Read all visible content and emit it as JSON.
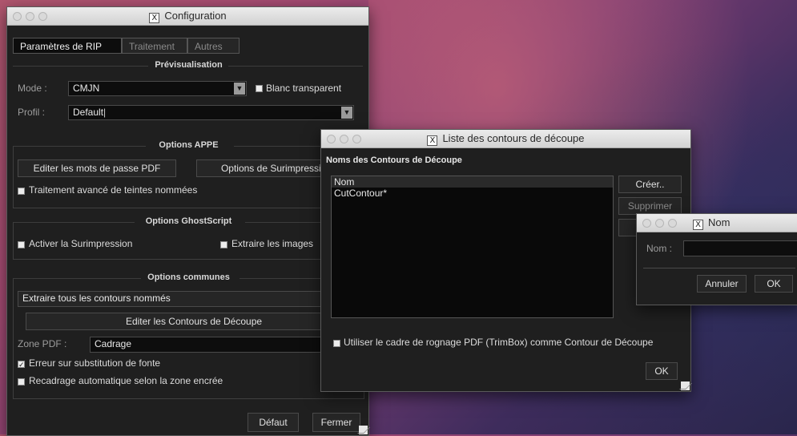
{
  "config": {
    "title": "Configuration",
    "tabs": [
      "Paramètres de RIP",
      "Traitement",
      "Autres"
    ],
    "preview": {
      "title": "Prévisualisation",
      "mode_label": "Mode",
      "mode_value": "CMJN",
      "white_label": "Blanc transparent",
      "profile_label": "Profil",
      "profile_value": "Default"
    },
    "appe": {
      "title": "Options APPE",
      "btn_passwords": "Editer les mots de passe PDF",
      "btn_overprint": "Options de Surimpression",
      "advanced_label": "Traitement avancé de teintes nommées"
    },
    "ghost": {
      "title": "Options GhostScript",
      "overprint_label": "Activer la Surimpression",
      "extract_label": "Extraire les images"
    },
    "common": {
      "title": "Options communes",
      "extract_value": "Extraire tous les contours nommés",
      "btn_edit": "Editer les Contours de Découpe",
      "zone_label": "Zone PDF",
      "zone_value": "Cadrage",
      "font_error_label": "Erreur sur substitution de fonte",
      "font_error_checked": true,
      "recrop_label": "Recadrage automatique selon la zone encrée"
    },
    "btn_default": "Défaut",
    "btn_close": "Fermer"
  },
  "contours": {
    "title": "Liste des contours de découpe",
    "section": "Noms des Contours de Découpe",
    "column": "Nom",
    "rows": [
      "CutContour*"
    ],
    "btn_create": "Créer..",
    "btn_delete": "Supprimer",
    "trimbox_label": "Utiliser le cadre de rognage PDF (TrimBox) comme Contour de Découpe",
    "btn_ok": "OK"
  },
  "nom": {
    "title": "Nom",
    "field_label": "Nom",
    "field_value": "",
    "btn_cancel": "Annuler",
    "btn_ok": "OK"
  },
  "icons": {
    "app_icon": "x11-icon",
    "dropdown": "dropdown-arrow-icon",
    "resize": "resize-grip-icon"
  }
}
